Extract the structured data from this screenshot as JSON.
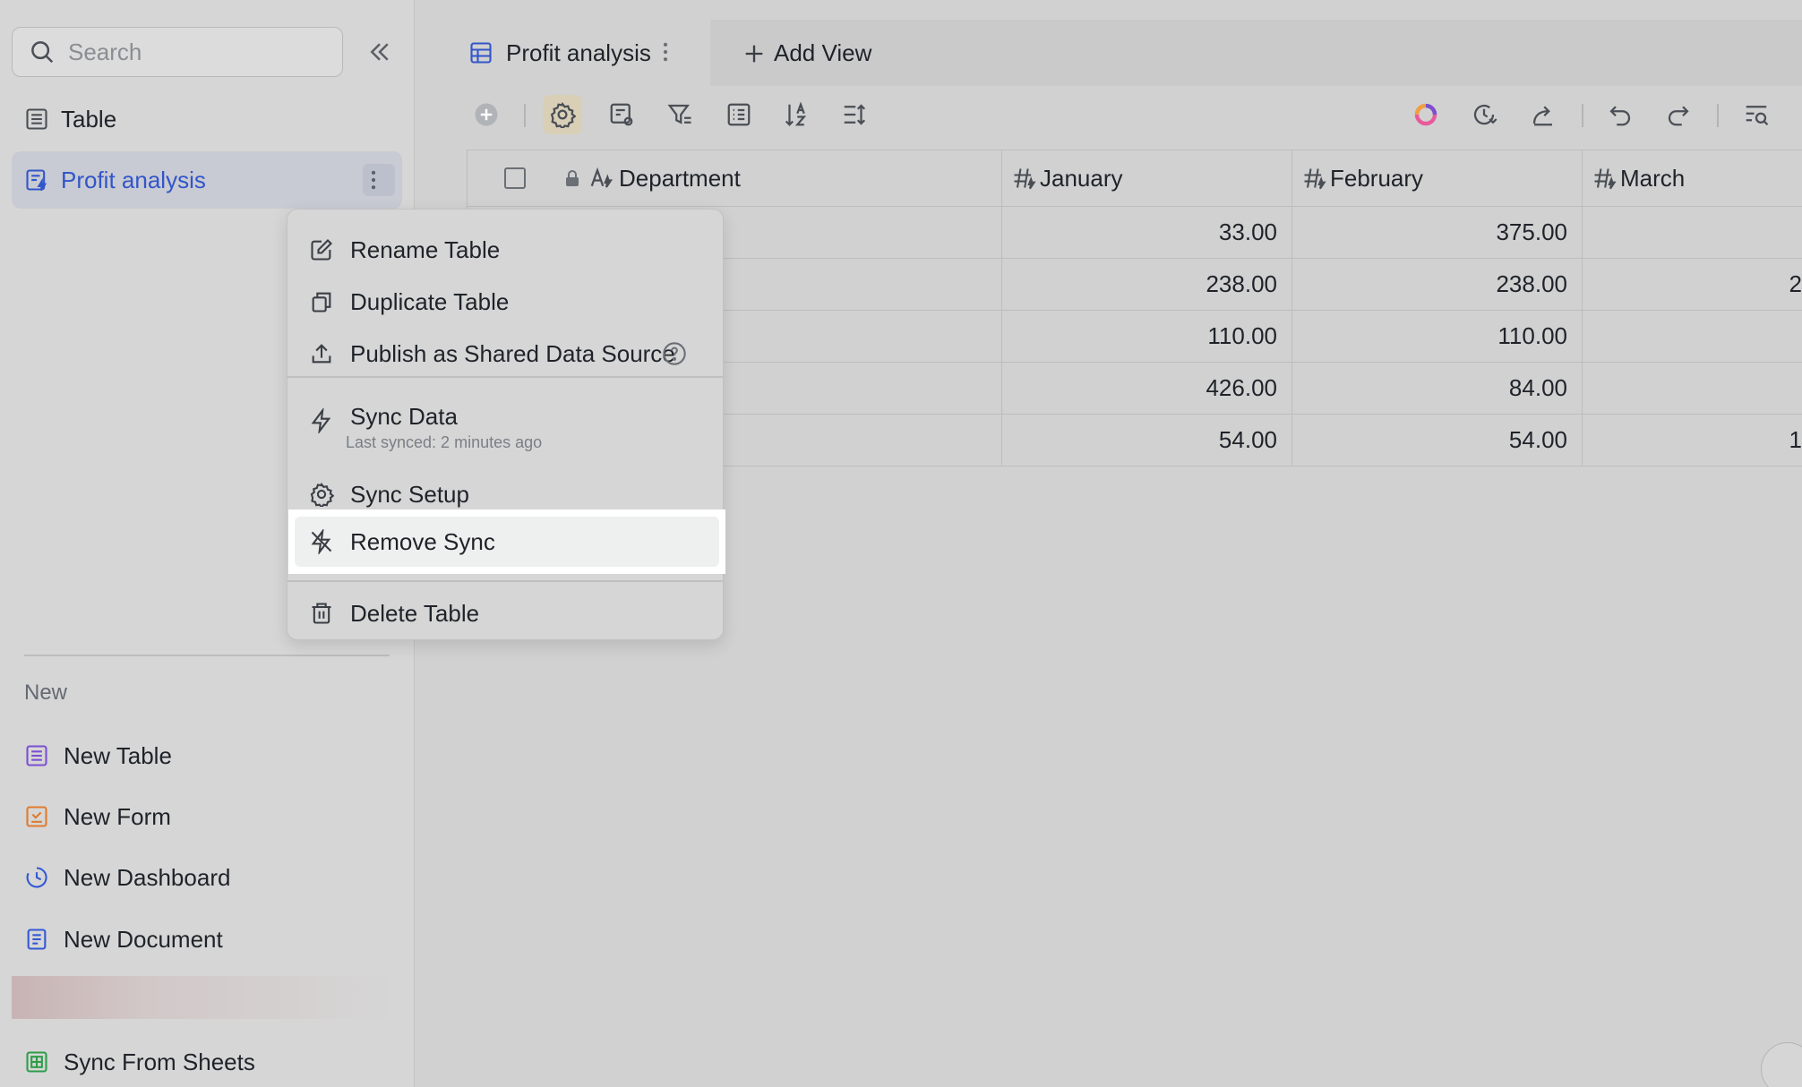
{
  "sidebar": {
    "search_placeholder": "Search",
    "items": [
      {
        "label": "Table",
        "icon": "table-icon"
      },
      {
        "label": "Profit analysis",
        "icon": "synced-table-icon"
      }
    ],
    "new_section": {
      "label": "New",
      "items": [
        {
          "label": "New Table",
          "icon": "table-icon",
          "color": "#7b4fd1"
        },
        {
          "label": "New Form",
          "icon": "form-icon",
          "color": "#e07a2e"
        },
        {
          "label": "New Dashboard",
          "icon": "dashboard-icon",
          "color": "#3358d4"
        },
        {
          "label": "New Document",
          "icon": "document-icon",
          "color": "#3358d4"
        },
        {
          "label": "Sync From Sheets",
          "icon": "sheets-icon",
          "color": "#2e9d49"
        }
      ]
    }
  },
  "tabs": {
    "active": "Profit analysis",
    "add_view": "Add View"
  },
  "grid": {
    "columns": [
      "Department",
      "January",
      "February",
      "March"
    ],
    "rows": [
      {
        "january": "33.00",
        "february": "375.00",
        "march": ""
      },
      {
        "january": "238.00",
        "february": "238.00",
        "march": "2"
      },
      {
        "january": "110.00",
        "february": "110.00",
        "march": ""
      },
      {
        "january": "426.00",
        "february": "84.00",
        "march": ""
      },
      {
        "january": "54.00",
        "february": "54.00",
        "march": "1"
      }
    ]
  },
  "menu": {
    "rename": "Rename Table",
    "duplicate": "Duplicate Table",
    "publish": "Publish as Shared Data Source",
    "sync_data": "Sync Data",
    "last_synced": "Last synced: 2 minutes ago",
    "sync_setup": "Sync Setup",
    "remove_sync": "Remove Sync",
    "delete": "Delete Table"
  },
  "colors": {
    "accent": "#3355c9",
    "highlight": "#ffffff"
  }
}
